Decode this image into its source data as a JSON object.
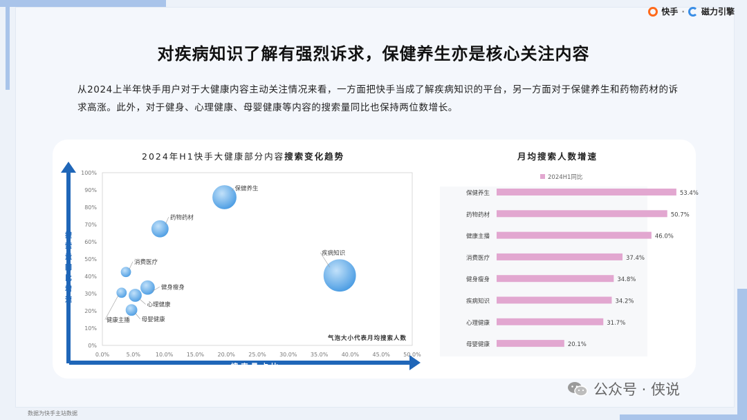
{
  "header": {
    "brand_1": "快手",
    "brand_sep": "·",
    "brand_2": "磁力引擎"
  },
  "title": "对疾病知识了解有强烈诉求，保健养生亦是核心关注内容",
  "description": "从2024上半年快手用户对于大健康内容主动关注情况来看，一方面把快手当成了解疾病知识的平台，另一方面对于保健养生和药物药材的诉求高涨。此外，对于健身、心理健康、母婴健康等内容的搜索量同比也保持两位数增长。",
  "footnote": "数据为快手主站数据",
  "watermark": "公众号 · 侠说",
  "colors": {
    "bubble_light": "#bfe0fa",
    "bubble_dark": "#3a93e0",
    "arrow": "#1f66b8",
    "bar": "#e2a7d0"
  },
  "chart_data": [
    {
      "type": "scatter",
      "title_prefix": "2024年H1快手大健康部分内容",
      "title_bold": "搜索变化趋势",
      "xlabel": "搜索量占比",
      "ylabel": "搜索量同比增速",
      "size_note": "气泡大小代表月均搜索人数",
      "xlim": [
        0,
        50
      ],
      "ylim": [
        0,
        100
      ],
      "x_ticks": [
        "0.0%",
        "5.0%",
        "10.0%",
        "15.0%",
        "20.0%",
        "25.0%",
        "30.0%",
        "35.0%",
        "40.0%",
        "45.0%",
        "50.0%"
      ],
      "y_ticks": [
        "0%",
        "10%",
        "20%",
        "30%",
        "40%",
        "50%",
        "60%",
        "70%",
        "80%",
        "90%",
        "100%"
      ],
      "points": [
        {
          "label": "保健养生",
          "x": 19.7,
          "y": 85.8,
          "size": 18
        },
        {
          "label": "药物药材",
          "x": 9.3,
          "y": 67.5,
          "size": 13
        },
        {
          "label": "疾病知识",
          "x": 38.3,
          "y": 40.5,
          "size": 24
        },
        {
          "label": "消费医疗",
          "x": 3.8,
          "y": 42.5,
          "size": 8
        },
        {
          "label": "健身瘦身",
          "x": 7.3,
          "y": 33.5,
          "size": 11
        },
        {
          "label": "心理健康",
          "x": 5.3,
          "y": 29.0,
          "size": 10
        },
        {
          "label": "健康主播",
          "x": 3.1,
          "y": 30.5,
          "size": 8
        },
        {
          "label": "母婴健康",
          "x": 4.7,
          "y": 20.5,
          "size": 9
        }
      ]
    },
    {
      "type": "bar",
      "orientation": "horizontal",
      "title": "月均搜索人数增速",
      "legend": "2024H1同比",
      "xlim": [
        0,
        60
      ],
      "categories": [
        "保健养生",
        "药物药材",
        "健康主播",
        "消费医疗",
        "健身瘦身",
        "疾病知识",
        "心理健康",
        "母婴健康"
      ],
      "values": [
        53.4,
        50.7,
        46.0,
        37.4,
        34.8,
        34.2,
        31.7,
        20.1
      ],
      "value_labels": [
        "53.4%",
        "50.7%",
        "46.0%",
        "37.4%",
        "34.8%",
        "34.2%",
        "31.7%",
        "20.1%"
      ]
    }
  ]
}
